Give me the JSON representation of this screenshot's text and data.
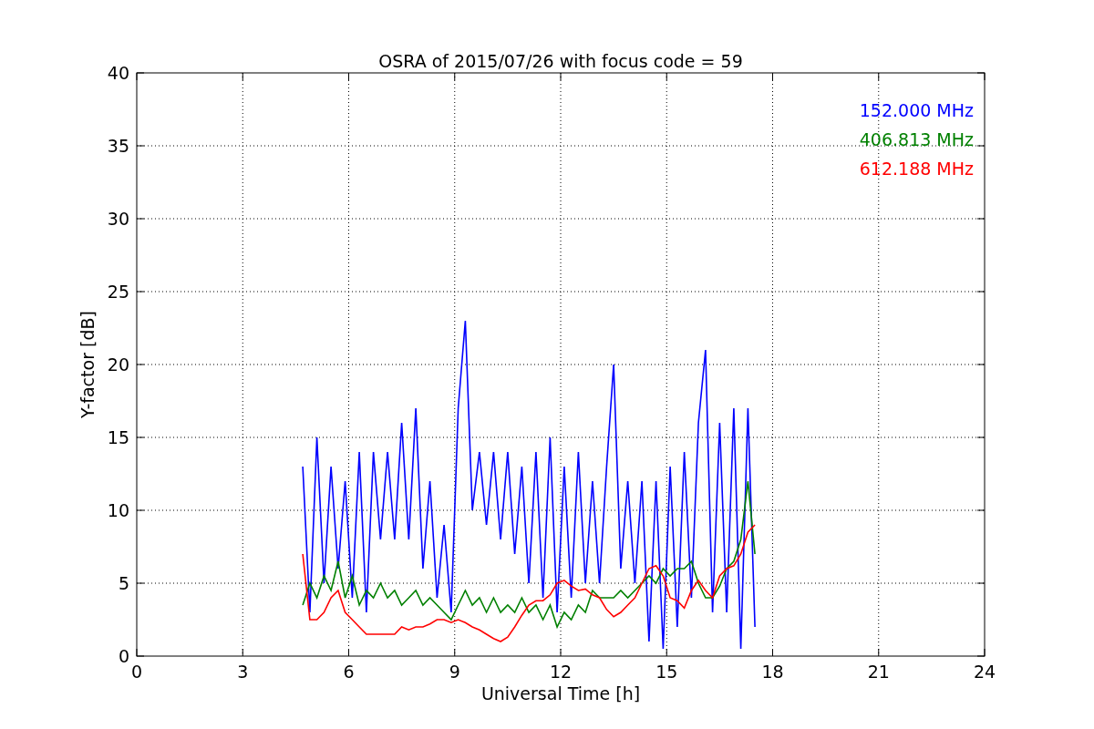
{
  "chart_data": {
    "type": "line",
    "title": "OSRA of 2015/07/26 with focus code = 59",
    "xlabel": "Universal Time [h]",
    "ylabel": "Y-factor [dB]",
    "xlim": [
      0,
      24
    ],
    "ylim": [
      0,
      40
    ],
    "xticks": [
      0,
      3,
      6,
      9,
      12,
      15,
      18,
      21,
      24
    ],
    "yticks": [
      0,
      5,
      10,
      15,
      20,
      25,
      30,
      35,
      40
    ],
    "grid": true,
    "x": [
      4.7,
      4.9,
      5.1,
      5.3,
      5.5,
      5.7,
      5.9,
      6.1,
      6.3,
      6.5,
      6.7,
      6.9,
      7.1,
      7.3,
      7.5,
      7.7,
      7.9,
      8.1,
      8.3,
      8.5,
      8.7,
      8.9,
      9.1,
      9.3,
      9.5,
      9.7,
      9.9,
      10.1,
      10.3,
      10.5,
      10.7,
      10.9,
      11.1,
      11.3,
      11.5,
      11.7,
      11.9,
      12.1,
      12.3,
      12.5,
      12.7,
      12.9,
      13.1,
      13.3,
      13.5,
      13.7,
      13.9,
      14.1,
      14.3,
      14.5,
      14.7,
      14.9,
      15.1,
      15.3,
      15.5,
      15.7,
      15.9,
      16.1,
      16.3,
      16.5,
      16.7,
      16.9,
      17.1,
      17.3,
      17.5
    ],
    "series": [
      {
        "name": "152.000 MHz",
        "color": "#0000ff",
        "values": [
          13,
          3,
          15,
          5,
          13,
          6,
          12,
          4,
          14,
          3,
          14,
          8,
          14,
          8,
          16,
          8,
          17,
          6,
          12,
          4,
          9,
          3,
          17,
          23,
          10,
          14,
          9,
          14,
          8,
          14,
          7,
          13,
          5,
          14,
          4,
          15,
          3,
          13,
          4,
          14,
          5,
          12,
          5,
          13,
          20,
          6,
          12,
          5,
          12,
          1,
          12,
          0.5,
          13,
          2,
          14,
          4,
          16,
          21,
          3,
          16,
          3,
          17,
          0.5,
          17,
          2
        ]
      },
      {
        "name": "406.813 MHz",
        "color": "#008000",
        "values": [
          3.5,
          5,
          4,
          5.5,
          4.5,
          6.5,
          4,
          5.5,
          3.5,
          4.5,
          4,
          5,
          4,
          4.5,
          3.5,
          4,
          4.5,
          3.5,
          4,
          3.5,
          3,
          2.5,
          3.5,
          4.5,
          3.5,
          4,
          3,
          4,
          3,
          3.5,
          3,
          4,
          3,
          3.5,
          2.5,
          3.5,
          2,
          3,
          2.5,
          3.5,
          3,
          4.5,
          4,
          4,
          4,
          4.5,
          4,
          4.5,
          5,
          5.5,
          5,
          6,
          5.5,
          6,
          6,
          6.5,
          5,
          4,
          4,
          4.8,
          6,
          6.5,
          8,
          12,
          7
        ]
      },
      {
        "name": "612.188 MHz",
        "color": "#ff0000",
        "values": [
          7,
          2.5,
          2.5,
          3,
          4,
          4.5,
          3,
          2.5,
          2,
          1.5,
          1.5,
          1.5,
          1.5,
          1.5,
          2,
          1.8,
          2,
          2,
          2.2,
          2.5,
          2.5,
          2.3,
          2.5,
          2.3,
          2,
          1.8,
          1.5,
          1.2,
          1,
          1.3,
          2,
          2.8,
          3.5,
          3.8,
          3.8,
          4.2,
          5,
          5.2,
          4.8,
          4.5,
          4.6,
          4.2,
          4,
          3.2,
          2.7,
          3,
          3.5,
          4,
          5,
          6,
          6.2,
          5.5,
          4,
          3.8,
          3.3,
          4.5,
          5.2,
          4.5,
          4,
          5.5,
          6,
          6.2,
          7,
          8.5,
          9
        ]
      }
    ]
  }
}
